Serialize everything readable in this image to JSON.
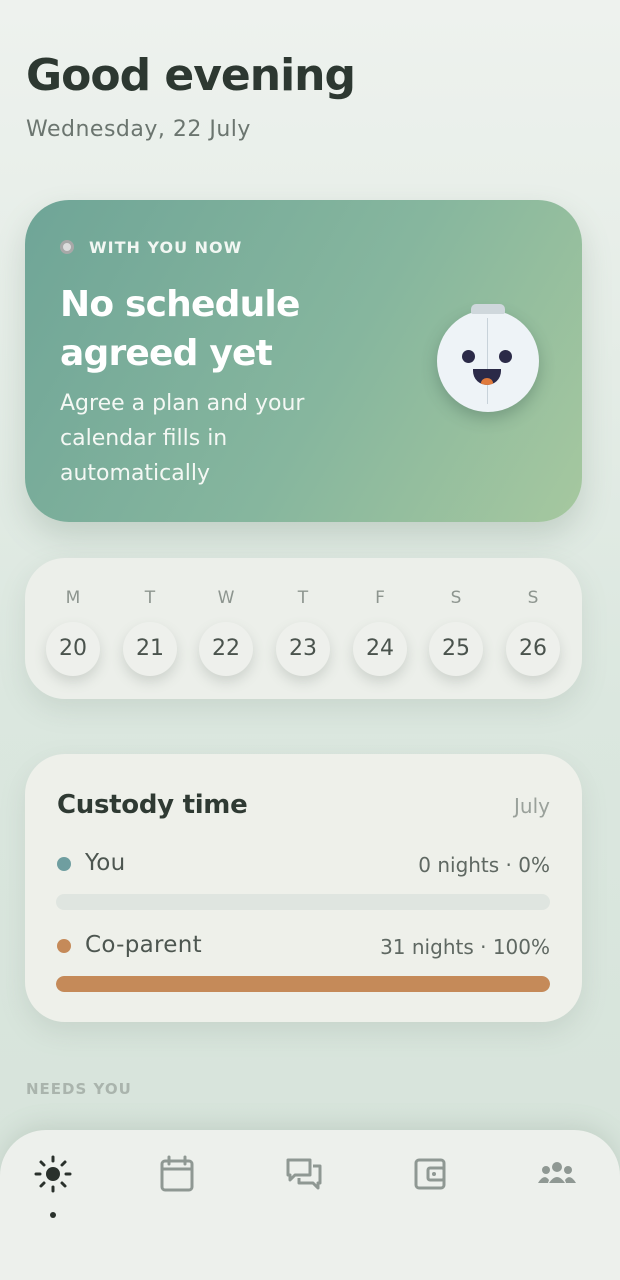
{
  "header": {
    "greeting": "Good evening",
    "date": "Wednesday, 22 July"
  },
  "now_card": {
    "label": "WITH YOU NOW",
    "title": "No schedule agreed yet",
    "subtitle": "Agree a plan and your calendar fills in automatically",
    "mascot_icon": "robot-face-icon"
  },
  "week": {
    "days": [
      {
        "letter": "M",
        "num": "20"
      },
      {
        "letter": "T",
        "num": "21"
      },
      {
        "letter": "W",
        "num": "22"
      },
      {
        "letter": "T",
        "num": "23"
      },
      {
        "letter": "F",
        "num": "24"
      },
      {
        "letter": "S",
        "num": "25"
      },
      {
        "letter": "S",
        "num": "26"
      }
    ]
  },
  "custody": {
    "title": "Custody time",
    "month": "July",
    "rows": [
      {
        "name": "You",
        "stat": "0 nights · 0%",
        "percent": 0,
        "color": "#6f9ea0"
      },
      {
        "name": "Co-parent",
        "stat": "31 nights · 100%",
        "percent": 100,
        "color": "#c58a59"
      }
    ]
  },
  "sections": {
    "needs_you": "NEEDS YOU"
  },
  "nav": {
    "items": [
      {
        "icon": "sun-icon",
        "active": true
      },
      {
        "icon": "calendar-icon",
        "active": false
      },
      {
        "icon": "chat-icon",
        "active": false
      },
      {
        "icon": "wallet-icon",
        "active": false
      },
      {
        "icon": "people-icon",
        "active": false
      }
    ]
  },
  "colors": {
    "accent_green": "#7fb09b",
    "coparent": "#c58a59",
    "you": "#6f9ea0"
  }
}
